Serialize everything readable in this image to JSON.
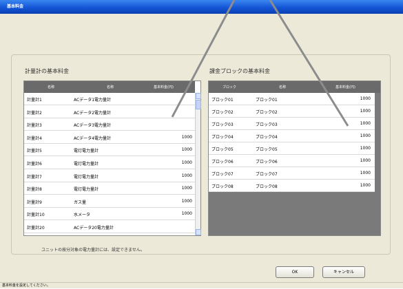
{
  "window": {
    "title": "基本料金"
  },
  "left_panel": {
    "title": "計量計の基本料金",
    "columns": [
      "名称",
      "名称",
      "基本料金(円)"
    ],
    "rows": [
      {
        "id": "計量計1",
        "name": "ACデータ1電力量計",
        "value": ""
      },
      {
        "id": "計量計2",
        "name": "ACデータ2電力量計",
        "value": ""
      },
      {
        "id": "計量計3",
        "name": "ACデータ3電力量計",
        "value": ""
      },
      {
        "id": "計量計4",
        "name": "ACデータ4電力量計",
        "value": "1000"
      },
      {
        "id": "計量計5",
        "name": "電灯電力量計",
        "value": "1000"
      },
      {
        "id": "計量計6",
        "name": "電灯電力量計",
        "value": "1000"
      },
      {
        "id": "計量計7",
        "name": "電灯電力量計",
        "value": "1000"
      },
      {
        "id": "計量計8",
        "name": "電灯電力量計",
        "value": "1000"
      },
      {
        "id": "計量計9",
        "name": "ガス量",
        "value": "1000"
      },
      {
        "id": "計量計10",
        "name": "水メータ",
        "value": "1000"
      },
      {
        "id": "計量計20",
        "name": "ACデータ20電力量計",
        "value": ""
      }
    ]
  },
  "right_panel": {
    "title": "課金ブロックの基本料金",
    "columns": [
      "ブロック",
      "名称",
      "基本料金(円)"
    ],
    "rows": [
      {
        "id": "ブロック01",
        "name": "ブロック01",
        "value": "1000"
      },
      {
        "id": "ブロック02",
        "name": "ブロック02",
        "value": "1000"
      },
      {
        "id": "ブロック03",
        "name": "ブロック03",
        "value": "1000"
      },
      {
        "id": "ブロック04",
        "name": "ブロック04",
        "value": "1000"
      },
      {
        "id": "ブロック05",
        "name": "ブロック05",
        "value": "1000"
      },
      {
        "id": "ブロック06",
        "name": "ブロック06",
        "value": "1000"
      },
      {
        "id": "ブロック07",
        "name": "ブロック07",
        "value": "1000"
      },
      {
        "id": "ブロック08",
        "name": "ブロック08",
        "value": "1000"
      }
    ]
  },
  "note": "ユニットの按分対象の電力量計には、設定できません。",
  "buttons": {
    "ok": "OK",
    "cancel": "キャンセル"
  },
  "status_bar": "基本料金を設定してください。",
  "colors": {
    "title_bar": "#1456d6",
    "header_bg": "#6a6a6a",
    "empty_area": "#7a7a7a",
    "annotation": "#8c8c8c"
  }
}
